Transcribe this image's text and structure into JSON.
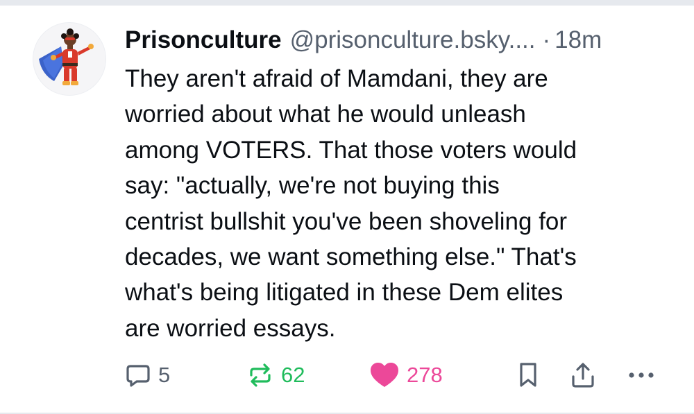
{
  "post": {
    "author": {
      "display_name": "Prisonculture",
      "handle": "@prisonculture.bsky....",
      "time_separator": "·",
      "time_ago": "18m"
    },
    "text_lines": [
      "They aren't afraid of Mamdani, they are",
      "worried about what he would unleash",
      "among VOTERS. That those voters would",
      "say: \"actually, we're not buying this",
      "centrist bullshit you've been shoveling for",
      "decades, we want something else.\" That's",
      "what's being litigated in these Dem elites",
      "are worried essays."
    ],
    "actions": {
      "reply_count": "5",
      "repost_count": "62",
      "like_count": "278"
    }
  },
  "icons": {
    "reply": "speech-bubble-icon",
    "repost": "repost-arrows-icon",
    "like": "heart-icon",
    "bookmark": "bookmark-icon",
    "share": "share-upload-icon",
    "more": "ellipsis-icon"
  },
  "colors": {
    "text": "#0b0f14",
    "muted": "#56606e",
    "repost_active": "#20bc5c",
    "like_active": "#ec4899",
    "border": "#e6e9ee"
  }
}
